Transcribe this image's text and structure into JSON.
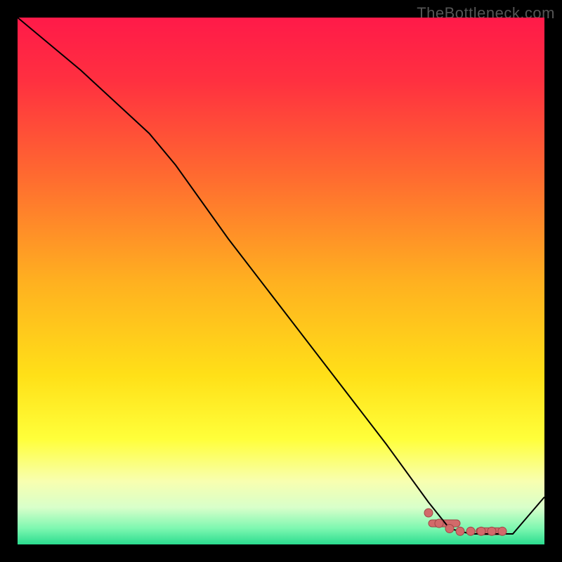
{
  "watermark": "TheBottleneck.com",
  "chart_data": {
    "type": "line",
    "title": "",
    "xlabel": "",
    "ylabel": "",
    "xlim": [
      0,
      100
    ],
    "ylim": [
      0,
      100
    ],
    "grid": false,
    "legend": false,
    "background_gradient": {
      "stops": [
        {
          "offset": 0.0,
          "color": "#ff1a49"
        },
        {
          "offset": 0.12,
          "color": "#ff3040"
        },
        {
          "offset": 0.3,
          "color": "#ff6a30"
        },
        {
          "offset": 0.5,
          "color": "#ffb020"
        },
        {
          "offset": 0.68,
          "color": "#ffe018"
        },
        {
          "offset": 0.8,
          "color": "#ffff3a"
        },
        {
          "offset": 0.88,
          "color": "#f8ffb0"
        },
        {
          "offset": 0.93,
          "color": "#d8ffca"
        },
        {
          "offset": 0.97,
          "color": "#7cf7b0"
        },
        {
          "offset": 1.0,
          "color": "#2bdc8f"
        }
      ]
    },
    "series": [
      {
        "name": "curve",
        "color": "#000000",
        "width": 2,
        "x": [
          0,
          12,
          25,
          30,
          40,
          50,
          60,
          70,
          78,
          82,
          86,
          90,
          94,
          100
        ],
        "y": [
          100,
          90,
          78,
          72,
          58,
          45,
          32,
          19,
          8,
          3,
          2,
          2,
          2,
          9
        ]
      }
    ],
    "markers": {
      "name": "flat-region-markers",
      "color": "#d26a6a",
      "stroke": "#a04848",
      "radius": 6,
      "points": [
        {
          "x": 78,
          "y": 6
        },
        {
          "x": 80,
          "y": 4
        },
        {
          "x": 82,
          "y": 3
        },
        {
          "x": 84,
          "y": 2.5
        },
        {
          "x": 86,
          "y": 2.5
        },
        {
          "x": 88,
          "y": 2.5
        },
        {
          "x": 90,
          "y": 2.5
        },
        {
          "x": 92,
          "y": 2.5
        }
      ],
      "bar_segments": [
        {
          "x0": 78,
          "x1": 84,
          "y": 4
        },
        {
          "x0": 87,
          "x1": 92,
          "y": 2.5
        }
      ]
    }
  }
}
